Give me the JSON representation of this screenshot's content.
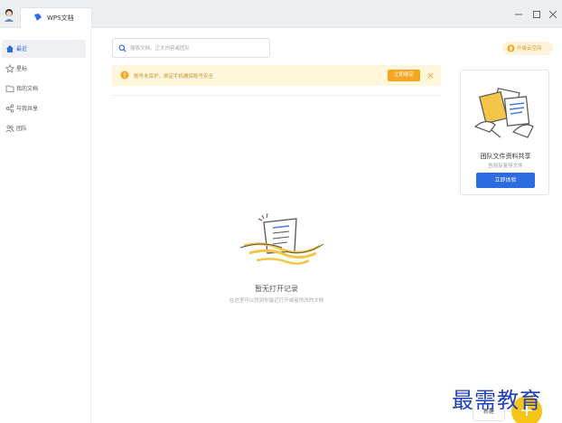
{
  "titlebar": {
    "tab_label": "WPS文档"
  },
  "sidebar": {
    "items": [
      {
        "label": "最近",
        "icon": "home-icon",
        "active": true
      },
      {
        "label": "星标",
        "icon": "star-icon"
      },
      {
        "label": "我的文档",
        "icon": "folder-icon"
      },
      {
        "label": "与我共享",
        "icon": "share-icon"
      },
      {
        "label": "团队",
        "icon": "team-icon"
      }
    ]
  },
  "search": {
    "placeholder": "搜索文档、正文内容或团队"
  },
  "upgrade": {
    "label": "升级云空间"
  },
  "notice": {
    "text": "账号未保护，绑定手机确保账号安全",
    "button_label": "立即绑定"
  },
  "promo": {
    "title": "团队文件资料共享",
    "subtitle": "告别反复传文件",
    "button_label": "立即体验"
  },
  "empty_state": {
    "title": "暂无打开记录",
    "subtitle": "在这里可以找到你最近打开或者修改的文档"
  },
  "footer": {
    "new_label": "新建"
  },
  "watermark": {
    "text": "最需教育"
  },
  "colors": {
    "accent": "#2b6de0",
    "warning_bg": "#fff6dc",
    "warning_btn": "#f5a623",
    "fab": "#f5c416"
  }
}
